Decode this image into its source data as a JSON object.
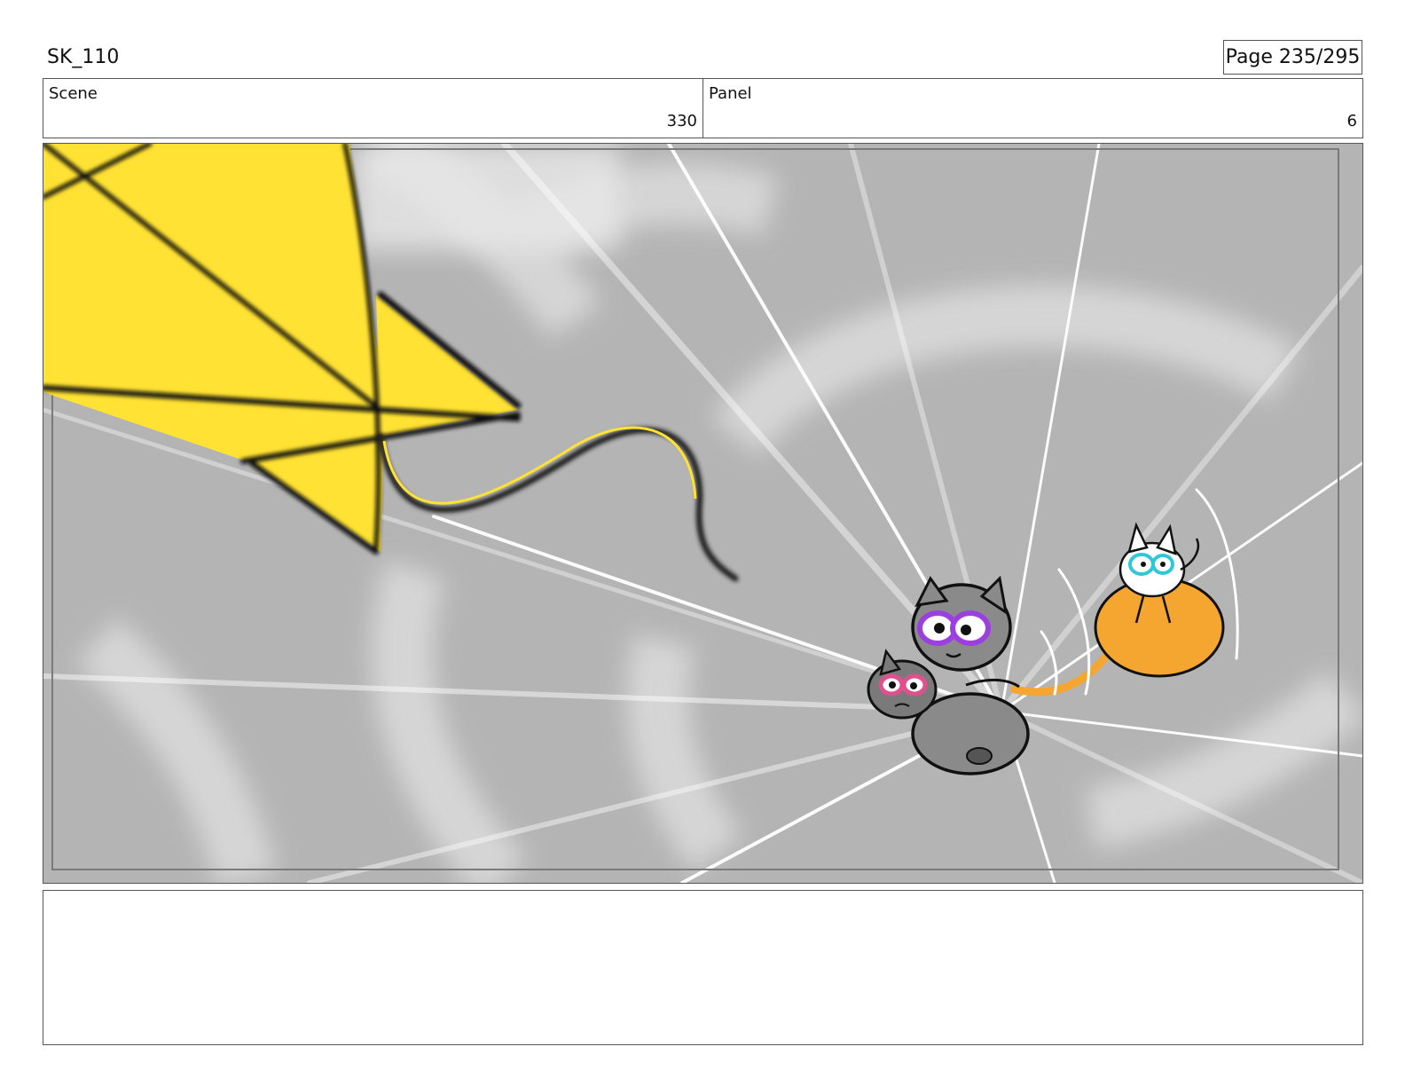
{
  "header": {
    "project_title": "SK_110",
    "page_indicator": "Page 235/295"
  },
  "info": {
    "scene_label": "Scene",
    "scene_value": "330",
    "panel_label": "Panel",
    "panel_value": "6"
  },
  "panel": {
    "background_color": "#b4b4b4",
    "kite_color": "#ffe233",
    "orange_cat_color": "#f5a630",
    "gray_cat_color": "#8a8a8a",
    "purple_eye_color": "#9b3fe0",
    "pink_eye_color": "#e0508f",
    "cyan_eye_color": "#2ec8d8"
  },
  "notes": {
    "text": ""
  }
}
